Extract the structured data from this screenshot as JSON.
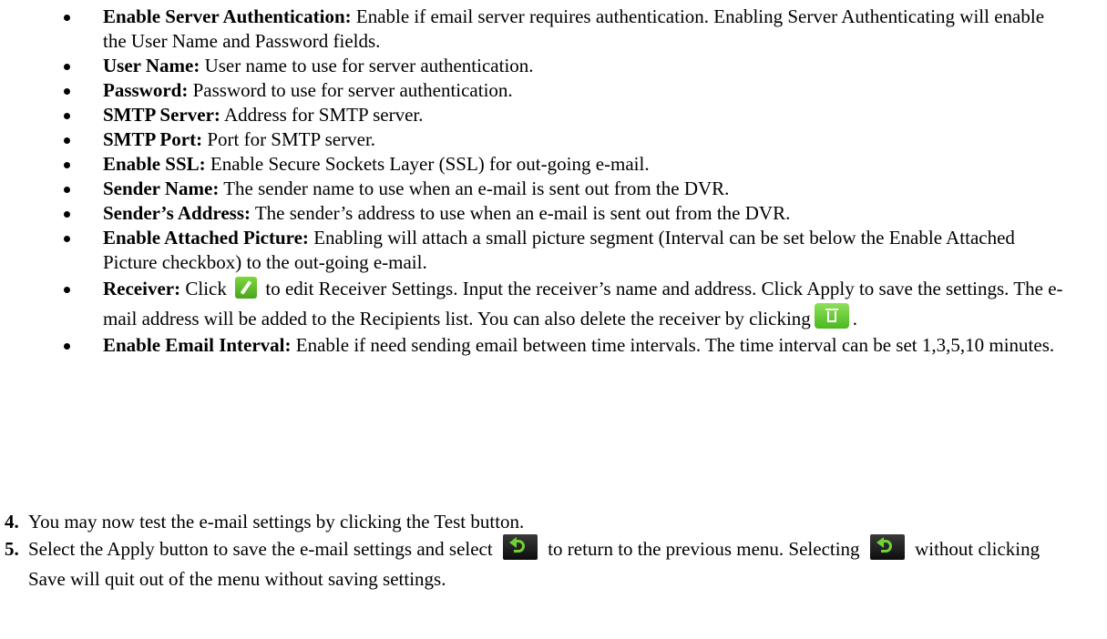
{
  "bullets": [
    {
      "term": "Enable Server Authentication:",
      "text": " Enable if email server requires authentication. Enabling Server Authenticating will enable the User Name and Password fields."
    },
    {
      "term": "User Name:",
      "text": " User name to use for server authentication."
    },
    {
      "term": "Password:",
      "text": " Password to use for server authentication."
    },
    {
      "term": "SMTP Server:",
      "text": " Address for SMTP server."
    },
    {
      "term": "SMTP Port:",
      "text": " Port for SMTP server."
    },
    {
      "term": "Enable SSL:",
      "text": " Enable Secure Sockets Layer (SSL) for out-going e-mail."
    },
    {
      "term": "Sender Name:",
      "text": " The sender name to use when an e-mail is sent out from the DVR."
    },
    {
      "term": "Sender’s Address:",
      "text": " The sender’s address to use when an e-mail is sent out from the DVR."
    },
    {
      "term": "Enable Attached Picture:",
      "text": " Enabling will attach a small picture segment (Interval can be set below the Enable Attached Picture checkbox) to the out-going e-mail."
    },
    {
      "term": "Receiver:",
      "text_a": " Click",
      "text_b": "to edit Receiver Settings. Input the receiver’s name and address. Click Apply to save the settings. The e-mail address will be added to the Recipients list. You can also delete the receiver by clicking",
      "text_c": "."
    },
    {
      "term": "Enable Email Interval:",
      "text": " Enable if need sending email between time intervals. The time interval can be set 1,3,5,10 minutes."
    }
  ],
  "steps": [
    {
      "num": "4.",
      "text": "You may now test the e-mail settings by clicking the Test button."
    },
    {
      "num": "5.",
      "text_a": "Select the Apply button to save the e-mail settings and select",
      "text_b": "to return to the previous menu. Selecting",
      "text_c": "without clicking Save will quit out of the menu without saving settings."
    }
  ],
  "icons": {
    "edit": "pencil-icon",
    "delete": "trash-icon",
    "back": "back-arrow-icon"
  },
  "colors": {
    "icon_green": "#5cc22a",
    "icon_dark": "#111111"
  }
}
